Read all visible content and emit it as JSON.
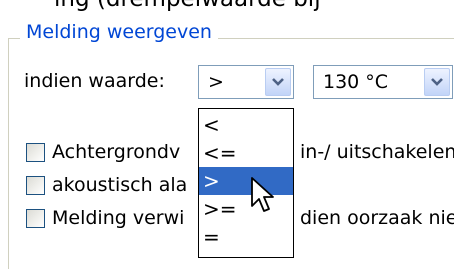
{
  "top_fragment": "ing (drempelwaarde bij",
  "group": {
    "title": "Melding weergeven"
  },
  "condition": {
    "label": "indien waarde:",
    "operator_value": ">",
    "threshold_value": "130 °C"
  },
  "operator_options": [
    "<",
    "<=",
    ">",
    ">=",
    "="
  ],
  "operator_selected_index": 2,
  "checkboxes": [
    {
      "left_text": "Achtergrondv",
      "right_text": "in-/ uitschakelen",
      "checked": false
    },
    {
      "left_text": "akoustisch ala",
      "right_text": "",
      "checked": false
    },
    {
      "left_text": "Melding verwi",
      "right_text": "dien oorzaak nie",
      "checked": false
    }
  ],
  "colors": {
    "group_title": "#0046d5",
    "selection": "#316ac5",
    "control_border": "#7f9db9"
  }
}
